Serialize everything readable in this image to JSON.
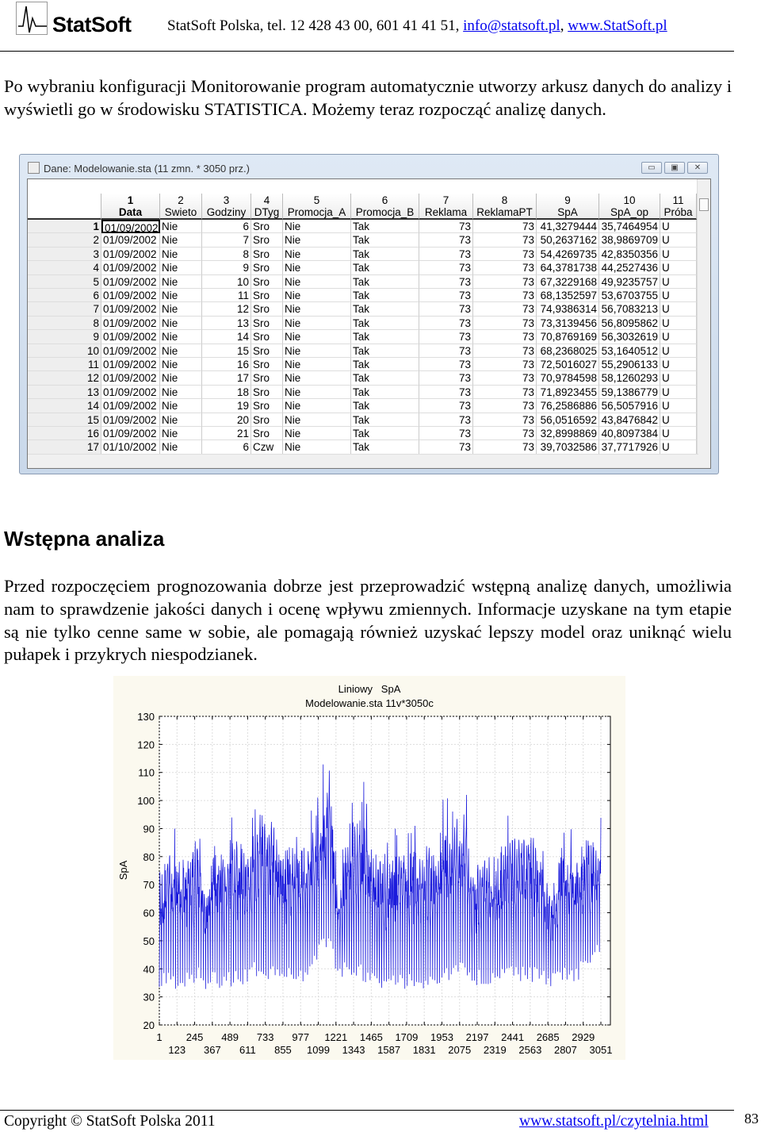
{
  "header": {
    "logo_text": "StatSoft",
    "contact": "StatSoft Polska, tel. 12 428 43 00, 601 41 41 51, ",
    "email": "info@statsoft.pl",
    "sep": ", ",
    "website": "www.StatSoft.pl"
  },
  "intro": "Po wybraniu konfiguracji Monitorowanie program automatycznie utworzy arkusz danych do analizy i wyświetli go w środowisku STATISTICA. Możemy teraz rozpocząć analizę danych.",
  "window": {
    "title": "Dane: Modelowanie.sta (11 zmn. * 3050 prz.)",
    "columns": [
      {
        "n": "1",
        "name": "Data"
      },
      {
        "n": "2",
        "name": "Swieto"
      },
      {
        "n": "3",
        "name": "Godziny"
      },
      {
        "n": "4",
        "name": "DTyg"
      },
      {
        "n": "5",
        "name": "Promocja_A"
      },
      {
        "n": "6",
        "name": "Promocja_B"
      },
      {
        "n": "7",
        "name": "Reklama"
      },
      {
        "n": "8",
        "name": "ReklamaPT"
      },
      {
        "n": "9",
        "name": "SpA"
      },
      {
        "n": "10",
        "name": "SpA_op"
      },
      {
        "n": "11",
        "name": "Próba"
      }
    ],
    "rows": [
      [
        "1",
        "01/09/2002",
        "Nie",
        "6",
        "Sro",
        "Nie",
        "Tak",
        "73",
        "73",
        "41,3279444",
        "35,7464954",
        "U"
      ],
      [
        "2",
        "01/09/2002",
        "Nie",
        "7",
        "Sro",
        "Nie",
        "Tak",
        "73",
        "73",
        "50,2637162",
        "38,9869709",
        "U"
      ],
      [
        "3",
        "01/09/2002",
        "Nie",
        "8",
        "Sro",
        "Nie",
        "Tak",
        "73",
        "73",
        "54,4269735",
        "42,8350356",
        "U"
      ],
      [
        "4",
        "01/09/2002",
        "Nie",
        "9",
        "Sro",
        "Nie",
        "Tak",
        "73",
        "73",
        "64,3781738",
        "44,2527436",
        "U"
      ],
      [
        "5",
        "01/09/2002",
        "Nie",
        "10",
        "Sro",
        "Nie",
        "Tak",
        "73",
        "73",
        "67,3229168",
        "49,9235757",
        "U"
      ],
      [
        "6",
        "01/09/2002",
        "Nie",
        "11",
        "Sro",
        "Nie",
        "Tak",
        "73",
        "73",
        "68,1352597",
        "53,6703755",
        "U"
      ],
      [
        "7",
        "01/09/2002",
        "Nie",
        "12",
        "Sro",
        "Nie",
        "Tak",
        "73",
        "73",
        "74,9386314",
        "56,7083213",
        "U"
      ],
      [
        "8",
        "01/09/2002",
        "Nie",
        "13",
        "Sro",
        "Nie",
        "Tak",
        "73",
        "73",
        "73,3139456",
        "56,8095862",
        "U"
      ],
      [
        "9",
        "01/09/2002",
        "Nie",
        "14",
        "Sro",
        "Nie",
        "Tak",
        "73",
        "73",
        "70,8769169",
        "56,3032619",
        "U"
      ],
      [
        "10",
        "01/09/2002",
        "Nie",
        "15",
        "Sro",
        "Nie",
        "Tak",
        "73",
        "73",
        "68,2368025",
        "53,1640512",
        "U"
      ],
      [
        "11",
        "01/09/2002",
        "Nie",
        "16",
        "Sro",
        "Nie",
        "Tak",
        "73",
        "73",
        "72,5016027",
        "55,2906133",
        "U"
      ],
      [
        "12",
        "01/09/2002",
        "Nie",
        "17",
        "Sro",
        "Nie",
        "Tak",
        "73",
        "73",
        "70,9784598",
        "58,1260293",
        "U"
      ],
      [
        "13",
        "01/09/2002",
        "Nie",
        "18",
        "Sro",
        "Nie",
        "Tak",
        "73",
        "73",
        "71,8923455",
        "59,1386779",
        "U"
      ],
      [
        "14",
        "01/09/2002",
        "Nie",
        "19",
        "Sro",
        "Nie",
        "Tak",
        "73",
        "73",
        "76,2586886",
        "56,5057916",
        "U"
      ],
      [
        "15",
        "01/09/2002",
        "Nie",
        "20",
        "Sro",
        "Nie",
        "Tak",
        "73",
        "73",
        "56,0516592",
        "43,8476842",
        "U"
      ],
      [
        "16",
        "01/09/2002",
        "Nie",
        "21",
        "Sro",
        "Nie",
        "Tak",
        "73",
        "73",
        "32,8998869",
        "40,8097384",
        "U"
      ],
      [
        "17",
        "01/10/2002",
        "Nie",
        "6",
        "Czw",
        "Nie",
        "Tak",
        "73",
        "73",
        "39,7032586",
        "37,7717926",
        "U"
      ]
    ]
  },
  "section": {
    "heading": "Wstępna analiza",
    "text": "Przed rozpoczęciem prognozowania dobrze jest przeprowadzić wstępną analizę danych, umożliwia nam to sprawdzenie jakości danych i ocenę wpływu zmiennych. Informacje uzyskane na tym etapie są nie tylko cenne same w sobie, ale pomagają również uzyskać lepszy model oraz uniknąć wielu pułapek i przykrych niespodzianek."
  },
  "chart_data": {
    "type": "line",
    "title": "Liniowy   SpA",
    "subtitle": "Modelowanie.sta 11v*3050c",
    "ylabel": "SpA",
    "xlabel": "",
    "ylim": [
      20,
      130
    ],
    "xlim": [
      1,
      3051
    ],
    "yticks": [
      "20",
      "30",
      "40",
      "50",
      "60",
      "70",
      "80",
      "90",
      "100",
      "110",
      "120",
      "130"
    ],
    "xticks_upper": [
      "1",
      "245",
      "489",
      "733",
      "977",
      "1221",
      "1465",
      "1709",
      "1953",
      "2197",
      "2441",
      "2685",
      "2929"
    ],
    "xticks_lower": [
      "123",
      "367",
      "611",
      "855",
      "1099",
      "1343",
      "1587",
      "1831",
      "2075",
      "2319",
      "2563",
      "2807",
      "3051"
    ],
    "grid": true,
    "color": "#1a1adc",
    "envelope": {
      "x": [
        8,
        53,
        155,
        269,
        314,
        371,
        485,
        587,
        689,
        803,
        894,
        962,
        1030,
        1121,
        1189,
        1234,
        1302,
        1416,
        1484,
        1597,
        1677,
        1825,
        1938,
        2040,
        2109,
        2165,
        2256,
        2347,
        2461,
        2563,
        2642,
        2699,
        2767,
        2881,
        2960,
        3051
      ],
      "high": [
        75,
        92,
        90,
        97,
        72,
        92,
        95,
        98,
        108,
        100,
        90,
        95,
        95,
        113,
        117,
        75,
        98,
        107,
        90,
        88,
        96,
        90,
        100,
        103,
        109,
        83,
        89,
        90,
        99,
        102,
        92,
        72,
        90,
        90,
        95,
        98
      ],
      "low": [
        33,
        33,
        32,
        36,
        32,
        33,
        33,
        34,
        38,
        35,
        35,
        35,
        35,
        45,
        45,
        34,
        38,
        35,
        33,
        33,
        32,
        33,
        33,
        37,
        36,
        34,
        34,
        35,
        35,
        35,
        34,
        32,
        36,
        35,
        40,
        46
      ]
    }
  },
  "footer": {
    "copyright": "Copyright © StatSoft Polska 2011",
    "link": "www.statsoft.pl/czytelnia.html",
    "page": "83"
  }
}
